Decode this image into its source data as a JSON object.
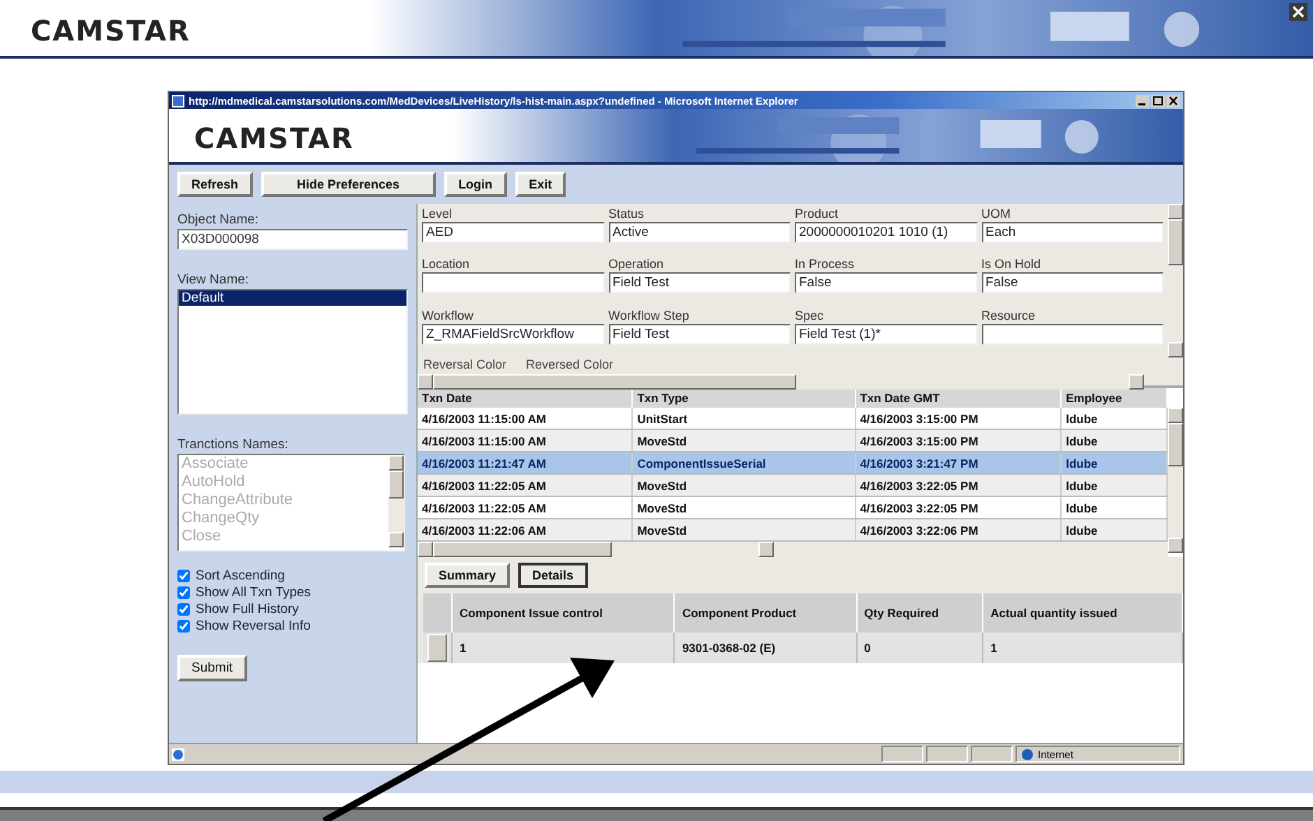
{
  "banner": {
    "logo": "CAMSTAR"
  },
  "browser": {
    "title": "http://mdmedical.camstarsolutions.com/MedDevices/LiveHistory/ls-hist-main.aspx?undefined - Microsoft Internet Explorer",
    "status_zone": "Internet"
  },
  "app": {
    "logo": "CAMSTAR"
  },
  "toolbar": {
    "buttons": [
      "Refresh",
      "Hide Preferences",
      "Login",
      "Exit"
    ]
  },
  "sidebar": {
    "object_name": {
      "label": "Object Name:",
      "value": "X03D000098"
    },
    "view_name": {
      "label": "View Name:",
      "items": [
        {
          "label": "Default",
          "selected": true
        }
      ]
    },
    "transaction_names": {
      "label": "Tranctions Names:",
      "disabled": true,
      "items": [
        {
          "label": "Associate",
          "selected": false
        },
        {
          "label": "AutoHold",
          "selected": false
        },
        {
          "label": "ChangeAttribute",
          "selected": false
        },
        {
          "label": "ChangeQty",
          "selected": false
        },
        {
          "label": "Close",
          "selected": false
        }
      ]
    },
    "options": [
      {
        "label": "Sort Ascending",
        "checked": true
      },
      {
        "label": "Show All Txn Types",
        "checked": true
      },
      {
        "label": "Show Full History",
        "checked": true
      },
      {
        "label": "Show Reversal Info",
        "checked": true
      }
    ],
    "submit": "Submit"
  },
  "details": {
    "fields": [
      {
        "label": "Level",
        "value": "AED"
      },
      {
        "label": "Status",
        "value": "Active"
      },
      {
        "label": "Product",
        "value": "2000000010201 1010 (1)"
      },
      {
        "label": "UOM",
        "value": "Each"
      },
      {
        "label": "Location"
      },
      {
        "label": "Operation",
        "value": "Field Test"
      },
      {
        "label": "In Process",
        "value": "False"
      },
      {
        "label": "Is On Hold",
        "value": "False"
      },
      {
        "label": "Workflow",
        "value": "Z_RMAFieldSrcWorkflow"
      },
      {
        "label": "Workflow Step",
        "value": "Field Test"
      },
      {
        "label": "Spec",
        "value": "Field Test (1)*"
      },
      {
        "label": "Resource"
      }
    ],
    "legend": [
      "Reversal Color",
      "Reversed Color"
    ]
  },
  "history": {
    "columns": [
      "Txn Date",
      "Txn Type",
      "Txn Date GMT",
      "Employee"
    ],
    "rows": [
      {
        "cells": [
          "4/16/2003 11:15:00 AM",
          "UnitStart",
          "4/16/2003 3:15:00 PM",
          "ldube"
        ],
        "selected": false
      },
      {
        "cells": [
          "4/16/2003 11:15:00 AM",
          "MoveStd",
          "4/16/2003 3:15:00 PM",
          "ldube"
        ],
        "selected": false
      },
      {
        "cells": [
          "4/16/2003 11:21:47 AM",
          "ComponentIssueSerial",
          "4/16/2003 3:21:47 PM",
          "ldube"
        ],
        "selected": true
      },
      {
        "cells": [
          "4/16/2003 11:22:05 AM",
          "MoveStd",
          "4/16/2003 3:22:05 PM",
          "ldube"
        ],
        "selected": false
      },
      {
        "cells": [
          "4/16/2003 11:22:05 AM",
          "MoveStd",
          "4/16/2003 3:22:05 PM",
          "ldube"
        ],
        "selected": false
      },
      {
        "cells": [
          "4/16/2003 11:22:06 AM",
          "MoveStd",
          "4/16/2003 3:22:06 PM",
          "ldube"
        ],
        "selected": false
      }
    ]
  },
  "view_buttons": [
    {
      "label": "Summary",
      "selected": false
    },
    {
      "label": "Details",
      "selected": true
    }
  ],
  "components": {
    "columns": [
      "Component Issue control",
      "Component Product",
      "Qty Required",
      "Actual quantity issued"
    ],
    "rows": [
      {
        "cells": [
          "1",
          "9301-0368-02 (E)",
          "0",
          "1"
        ]
      }
    ]
  }
}
